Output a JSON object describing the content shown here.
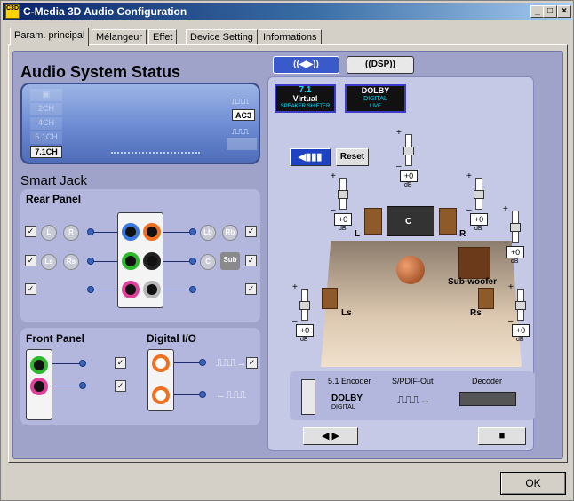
{
  "window": {
    "title": "C-Media 3D Audio Configuration",
    "icon_text": "C3D",
    "minimize": "_",
    "maximize": "□",
    "close": "×"
  },
  "tabs": [
    {
      "label": "Param. principal",
      "active": true
    },
    {
      "label": "Mélangeur",
      "active": false
    },
    {
      "label": "Effet",
      "active": false
    },
    {
      "label": "Device Setting",
      "active": false
    },
    {
      "label": "Informations",
      "active": false
    }
  ],
  "status": {
    "heading": "Audio System Status",
    "channels": [
      "2CH",
      "4CH",
      "5.1CH",
      "7.1CH"
    ],
    "selected_channel": "7.1CH",
    "source": "AC3"
  },
  "smart_jack": {
    "heading": "Smart Jack",
    "rear_panel": {
      "title": "Rear Panel",
      "speakers": {
        "row1_left": [
          "L",
          "R"
        ],
        "row2_left": [
          "Ls",
          "Rs"
        ],
        "row1_right": [
          "Lb",
          "Rb"
        ],
        "row2_right": [
          "C",
          "Sub"
        ]
      },
      "check_glyph": "✓"
    },
    "front_panel": {
      "title": "Front Panel"
    },
    "digital_io": {
      "title": "Digital I/O"
    }
  },
  "speaker_panel": {
    "modes": [
      "((◀▶))",
      "((DSP))"
    ],
    "logos": {
      "virtual": {
        "top": "7.1",
        "middle": "Virtual",
        "bottom": "SPEAKER SHIFTER"
      },
      "dolby": {
        "top": "DOLBY",
        "middle": "DIGITAL",
        "bottom": "LIVE"
      }
    },
    "mute_icon": "◀▮▮▮",
    "reset_label": "Reset",
    "channels": [
      {
        "id": "c",
        "label": "C",
        "value": "+0",
        "unit": "dB"
      },
      {
        "id": "l",
        "label": "L",
        "value": "+0",
        "unit": "dB"
      },
      {
        "id": "r",
        "label": "R",
        "value": "+0",
        "unit": "dB"
      },
      {
        "id": "lb",
        "label": "",
        "value": "+0",
        "unit": "dB"
      },
      {
        "id": "ls",
        "label": "Ls",
        "value": "+0",
        "unit": "dB"
      },
      {
        "id": "rs",
        "label": "Rs",
        "value": "+0",
        "unit": "dB"
      },
      {
        "id": "sub",
        "label": "Sub-woofer",
        "value": "+0",
        "unit": "dB"
      }
    ],
    "plus": "+",
    "minus": "–"
  },
  "encoder": {
    "encoder_label": "5.1 Encoder",
    "spdif_label": "S/PDIF-Out",
    "decoder_label": "Decoder",
    "dolby_text": "DOLBY",
    "dolby_sub": "DIGITAL"
  },
  "controls": {
    "play_label": "◀ ▶",
    "stop_label": "■"
  },
  "ok_label": "OK",
  "colors": {
    "title_start": "#0a246a",
    "panel_bg": "#9fa3c9",
    "lcd": "#6b8ad2",
    "jack_green": "#2db82d",
    "jack_pink": "#e0409a",
    "jack_orange": "#f07020",
    "jack_blue": "#3a7ae0"
  }
}
